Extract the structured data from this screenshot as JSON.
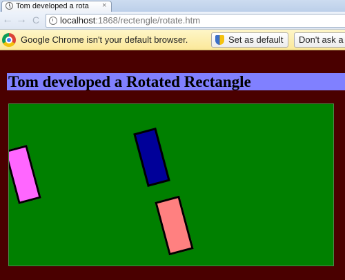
{
  "browser": {
    "tab": {
      "title": "Tom developed a rota",
      "close": "×"
    },
    "nav": {
      "back": "←",
      "forward": "→",
      "reload": "C"
    },
    "address": {
      "host": "localhost",
      "path": ":1868/rectengle/rotate.htm"
    },
    "infobar": {
      "message": "Google Chrome isn't your default browser.",
      "set_default_label": "Set as default",
      "dont_ask_label": "Don't ask a"
    }
  },
  "page": {
    "heading": "Tom developed a Rotated Rectangle",
    "background_color": "#4a0000",
    "heading_bar_color": "#8080ff",
    "canvas": {
      "fill_color": "#008000",
      "rectangles": [
        {
          "name": "magenta",
          "fill": "#ff66ff",
          "stroke": "#000000",
          "rotation_deg": -15
        },
        {
          "name": "blue",
          "fill": "#000099",
          "stroke": "#000000",
          "rotation_deg": -15
        },
        {
          "name": "pink",
          "fill": "#ff8080",
          "stroke": "#000000",
          "rotation_deg": -15
        }
      ]
    }
  }
}
